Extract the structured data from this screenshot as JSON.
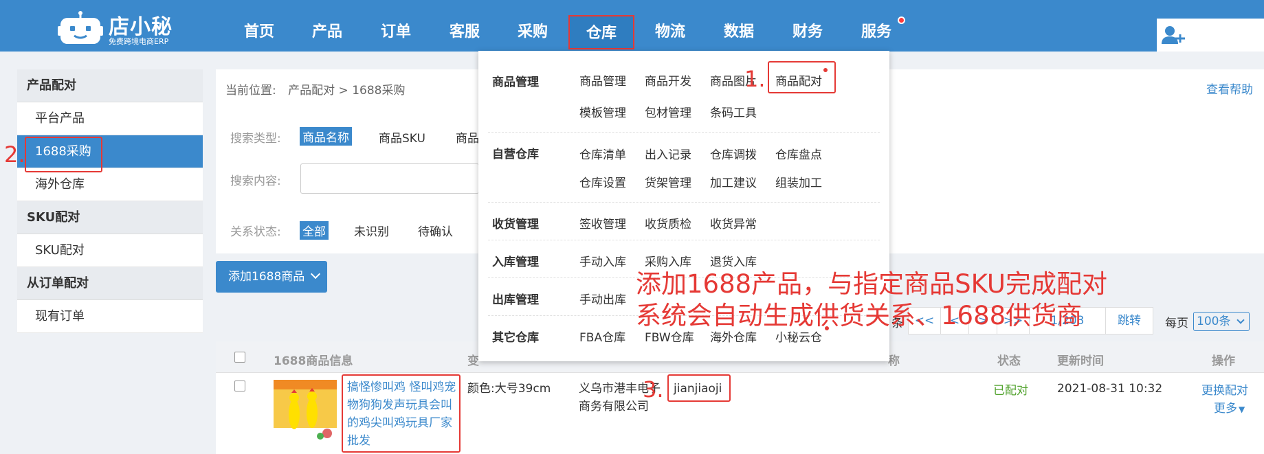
{
  "app": {
    "logo_name": "店小秘",
    "logo_slogan": "免费跨境电商ERP"
  },
  "nav": {
    "items": [
      "首页",
      "产品",
      "订单",
      "客服",
      "采购",
      "仓库",
      "物流",
      "数据",
      "财务",
      "服务"
    ],
    "active": "仓库"
  },
  "sidebar": {
    "groups": [
      {
        "title": "产品配对",
        "items": [
          "平台产品",
          "1688采购",
          "海外仓库"
        ]
      },
      {
        "title": "SKU配对",
        "items": [
          "SKU配对"
        ]
      },
      {
        "title": "从订单配对",
        "items": [
          "现有订单"
        ]
      }
    ],
    "active_item": "1688采购"
  },
  "breadcrumb": {
    "prefix": "当前位置:",
    "path": "产品配对 > 1688采购"
  },
  "help_link": "查看帮助",
  "filters": {
    "search_type_label": "搜索类型:",
    "search_types": [
      "商品名称",
      "商品SKU",
      "商品"
    ],
    "search_content_label": "搜索内容:",
    "relation_label": "关系状态:",
    "relation_options": [
      "全部",
      "未识别",
      "待确认"
    ]
  },
  "add_button": "添加1688商品",
  "pagination": {
    "partial_label": "条",
    "first": "<<",
    "prev": "<",
    "next": ">",
    "last": ">>",
    "page": "1/203",
    "jump": "跳转",
    "per_page_label": "每页",
    "per_page_value": "100条"
  },
  "table": {
    "headers": [
      "1688商品信息",
      "变",
      "称",
      "状态",
      "更新时间",
      "操作"
    ],
    "rows": [
      {
        "title": "搞怪惨叫鸡 怪叫鸡宠物狗狗发声玩具会叫的鸡尖叫鸡玩具厂家批发",
        "variant": "颜色:大号39cm",
        "supplier": "义乌市港丰电子商务有限公司",
        "supplier_id": "jianjiaoji",
        "status": "已配对",
        "updated": "2021-08-31 10:32",
        "op_change": "更换配对",
        "op_more": "更多"
      }
    ]
  },
  "dropdown": {
    "sections": [
      {
        "title": "商品管理",
        "rows": [
          [
            "商品管理",
            "商品开发",
            "商品图片",
            "商品配对"
          ],
          [
            "模板管理",
            "包材管理",
            "条码工具"
          ]
        ]
      },
      {
        "title": "自营仓库",
        "rows": [
          [
            "仓库清单",
            "出入记录",
            "仓库调拨",
            "仓库盘点"
          ],
          [
            "仓库设置",
            "货架管理",
            "加工建议",
            "组装加工"
          ]
        ]
      },
      {
        "title": "收货管理",
        "rows": [
          [
            "签收管理",
            "收货质检",
            "收货异常"
          ]
        ]
      },
      {
        "title": "入库管理",
        "rows": [
          [
            "手动入库",
            "采购入库",
            "退货入库"
          ]
        ]
      },
      {
        "title": "出库管理",
        "rows": [
          [
            "手动出库"
          ]
        ]
      },
      {
        "title": "其它仓库",
        "rows": [
          [
            "FBA仓库",
            "FBW仓库",
            "海外仓库",
            "小秘云仓"
          ]
        ]
      }
    ]
  },
  "annotations": {
    "step1": "1.",
    "step2": "2.",
    "step3": "3.",
    "line1": "添加1688产品，与指定商品SKU完成配对",
    "line2": "系统会自动生成供货关系、1688供货商"
  },
  "colors": {
    "primary": "#3b89cc",
    "annotation_red": "#e53935",
    "status_green": "#52a32e"
  }
}
